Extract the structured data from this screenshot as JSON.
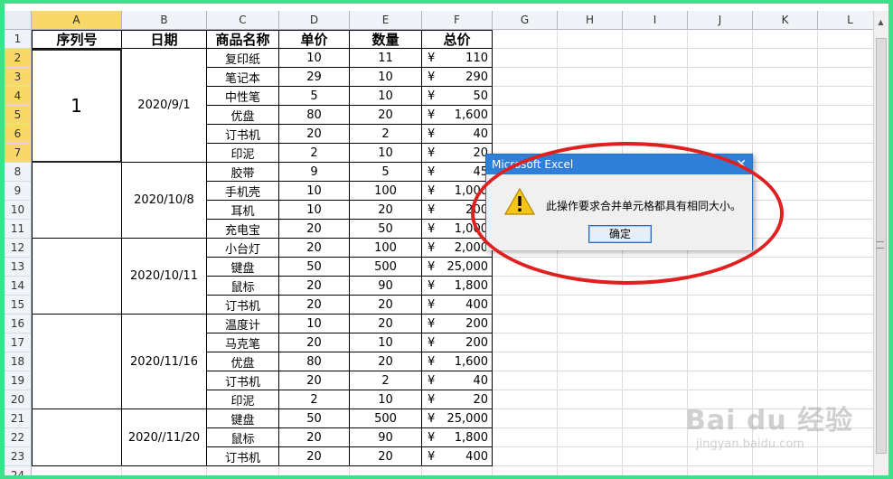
{
  "columns": [
    "A",
    "B",
    "C",
    "D",
    "E",
    "F",
    "G",
    "H",
    "I",
    "J",
    "K",
    "L"
  ],
  "selected_column": "A",
  "rows": [
    "1",
    "2",
    "3",
    "4",
    "5",
    "6",
    "7",
    "8",
    "9",
    "10",
    "11",
    "12",
    "13",
    "14",
    "15",
    "16",
    "17",
    "18",
    "19",
    "20",
    "21",
    "22",
    "23",
    "24"
  ],
  "selected_rows": [
    "2",
    "3",
    "4",
    "5",
    "6",
    "7"
  ],
  "headers": [
    "序列号",
    "日期",
    "商品名称",
    "单价",
    "数量",
    "总价"
  ],
  "groups": [
    {
      "serial": "1",
      "date": "2020/9/1"
    },
    {
      "serial": "",
      "date": "2020/10/8"
    },
    {
      "serial": "",
      "date": "2020/10/11"
    },
    {
      "serial": "",
      "date": "2020/11/16"
    },
    {
      "serial": "",
      "date": "2020//11/20"
    }
  ],
  "currency": "¥",
  "items": [
    {
      "name": "复印纸",
      "price": "10",
      "qty": "11",
      "total": "110"
    },
    {
      "name": "笔记本",
      "price": "29",
      "qty": "10",
      "total": "290"
    },
    {
      "name": "中性笔",
      "price": "5",
      "qty": "10",
      "total": "50"
    },
    {
      "name": "优盘",
      "price": "80",
      "qty": "20",
      "total": "1,600"
    },
    {
      "name": "订书机",
      "price": "20",
      "qty": "2",
      "total": "40"
    },
    {
      "name": "印泥",
      "price": "2",
      "qty": "10",
      "total": "20"
    },
    {
      "name": "胶带",
      "price": "9",
      "qty": "5",
      "total": "45"
    },
    {
      "name": "手机壳",
      "price": "10",
      "qty": "100",
      "total": "1,000"
    },
    {
      "name": "耳机",
      "price": "10",
      "qty": "20",
      "total": "200"
    },
    {
      "name": "充电宝",
      "price": "20",
      "qty": "50",
      "total": "1,000"
    },
    {
      "name": "小台灯",
      "price": "20",
      "qty": "100",
      "total": "2,000"
    },
    {
      "name": "键盘",
      "price": "50",
      "qty": "500",
      "total": "25,000"
    },
    {
      "name": "鼠标",
      "price": "20",
      "qty": "90",
      "total": "1,800"
    },
    {
      "name": "订书机",
      "price": "20",
      "qty": "20",
      "total": "400"
    },
    {
      "name": "温度计",
      "price": "10",
      "qty": "20",
      "total": "200"
    },
    {
      "name": "马克笔",
      "price": "20",
      "qty": "10",
      "total": "200"
    },
    {
      "name": "优盘",
      "price": "80",
      "qty": "20",
      "total": "1,600"
    },
    {
      "name": "订书机",
      "price": "20",
      "qty": "2",
      "total": "40"
    },
    {
      "name": "印泥",
      "price": "2",
      "qty": "10",
      "total": "20"
    },
    {
      "name": "键盘",
      "price": "50",
      "qty": "500",
      "total": "25,000"
    },
    {
      "name": "鼠标",
      "price": "20",
      "qty": "90",
      "total": "1,800"
    },
    {
      "name": "订书机",
      "price": "20",
      "qty": "20",
      "total": "400"
    }
  ],
  "dialog": {
    "title": "Microsoft Excel",
    "close": "✕",
    "message": "此操作要求合并单元格都具有相同大小。",
    "ok_label": "确定",
    "icon": "warning-icon"
  },
  "watermark": {
    "line1": "Bai du 经验",
    "line2": "jingyan.baidu.com"
  },
  "colors": {
    "selection_header": "#f9d86a",
    "annotation_ring": "#e01f1f",
    "dialog_title": "#2f7fd7",
    "frame": "#3ee08a"
  }
}
